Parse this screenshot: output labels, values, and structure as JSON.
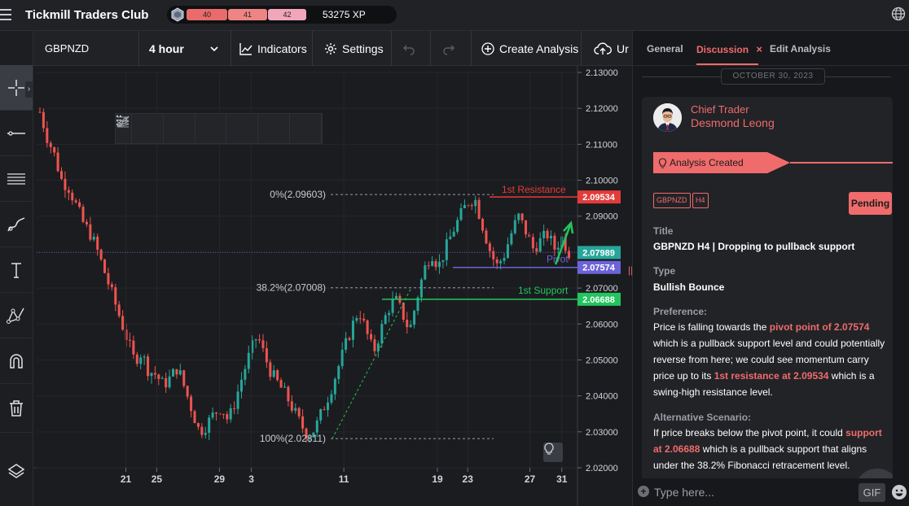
{
  "app": {
    "title": "Tickmill Traders Club",
    "xp_levels": [
      "40",
      "41",
      "42"
    ],
    "xp_total": "53275 XP"
  },
  "chart_header": {
    "symbol": "GBPNZD",
    "timeframe": "4 hour",
    "indicators_label": "Indicators",
    "settings_label": "Settings",
    "create_analysis_label": "Create Analysis",
    "upload_label": "Ur"
  },
  "left_tools": [
    "crosshair-icon",
    "horizontal-line-icon",
    "multi-line-icon",
    "brush-icon",
    "text-icon",
    "pattern-icon",
    "magnet-icon",
    "trash-icon",
    "layers-icon"
  ],
  "panel": {
    "tabs": [
      {
        "label": "General"
      },
      {
        "label": "Discussion",
        "close": "×"
      },
      {
        "label": "Edit Analysis"
      }
    ],
    "date": "OCTOBER 30, 2023",
    "author_role": "Chief Trader",
    "author_name": "Desmond Leong",
    "status_banner": "Analysis Created",
    "tags": [
      "GBPNZD",
      "H4"
    ],
    "status": "Pending",
    "title_label": "Title",
    "title_value": "GBPNZD H4 | Dropping to pullback support",
    "type_label": "Type",
    "type_value": "Bullish Bounce",
    "preference_label": "Preference:",
    "preference": {
      "t1": "Price is falling towards the ",
      "h1": "pivot point of 2.07574",
      "t2": " which is a pullback support level and could potentially reverse from here; we could see momentum carry price up to its ",
      "h2": "1st resistance at 2.09534",
      "t3": " which is a swing-high resistance level."
    },
    "alt_label": "Alternative Scenario:",
    "alternative": {
      "t1": "If price breaks below the pivot point, it could ",
      "h1": "support at 2.06688",
      "t2": " which is a pullback support that aligns under the 38.2% Fibonacci retracement level."
    }
  },
  "composer": {
    "placeholder": "Type here...",
    "gif_label": "GIF"
  },
  "colors": {
    "up": "#26a69a",
    "down": "#ef5350",
    "accent": "#f06b6b",
    "resistance": "#e33b3b",
    "support": "#22c55e",
    "pivot": "#6c63d8"
  },
  "chart_data": {
    "type": "candlestick",
    "symbol": "GBPNZD",
    "timeframe": "H4",
    "ylim": [
      2.02,
      2.13
    ],
    "y_ticks": [
      "2.13000",
      "2.12000",
      "2.11000",
      "2.10000",
      "2.09000",
      "2.08000",
      "2.07000",
      "2.06000",
      "2.05000",
      "2.04000",
      "2.03000",
      "2.02000"
    ],
    "x_tick_labels": [
      "21",
      "25",
      "29",
      "3",
      "11",
      "19",
      "23",
      "27",
      "31"
    ],
    "current_price": "2.07989",
    "levels": [
      {
        "name": "1st Resistance",
        "value": 2.09534,
        "label": "2.09534"
      },
      {
        "name": "Pivot",
        "value": 2.07574,
        "label": "2.07574"
      },
      {
        "name": "1st Support",
        "value": 2.06688,
        "label": "2.06688"
      }
    ],
    "fibonacci": [
      {
        "label": "0%(2.09603)",
        "value": 2.09603
      },
      {
        "label": "38.2%(2.07008)",
        "value": 2.07008
      },
      {
        "label": "100%(2.02811)",
        "value": 2.02811
      }
    ],
    "price_path": [
      2.119,
      2.112,
      2.107,
      2.1,
      2.098,
      2.093,
      2.088,
      2.085,
      2.08,
      2.074,
      2.068,
      2.062,
      2.056,
      2.05,
      2.052,
      2.047,
      2.046,
      2.043,
      2.045,
      2.048,
      2.042,
      2.036,
      2.03,
      2.032,
      2.035,
      2.037,
      2.033,
      2.039,
      2.046,
      2.052,
      2.057,
      2.051,
      2.046,
      2.043,
      2.04,
      2.036,
      2.032,
      2.029,
      2.031,
      2.036,
      2.041,
      2.047,
      2.053,
      2.059,
      2.064,
      2.058,
      2.052,
      2.058,
      2.064,
      2.067,
      2.063,
      2.058,
      2.067,
      2.075,
      2.08,
      2.076,
      2.081,
      2.086,
      2.09,
      2.094,
      2.095,
      2.088,
      2.081,
      2.076,
      2.079,
      2.085,
      2.09,
      2.086,
      2.081,
      2.083,
      2.085,
      2.081,
      2.084,
      2.08
    ]
  }
}
